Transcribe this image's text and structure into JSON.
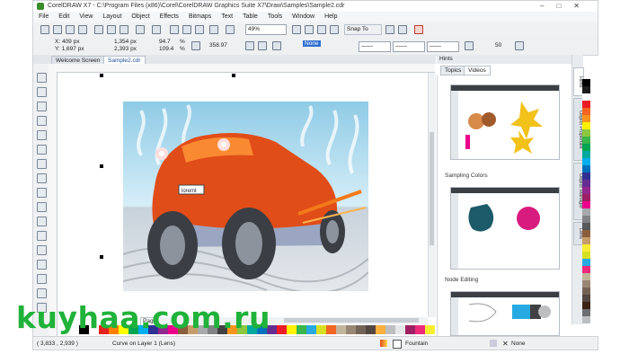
{
  "window": {
    "title": "CorelDRAW X7 - C:\\Program Files (x86)\\Corel\\CorelDRAW Graphics Suite X7\\Draw\\Samples\\Sample2.cdr"
  },
  "menu": [
    "File",
    "Edit",
    "View",
    "Layout",
    "Object",
    "Effects",
    "Bitmaps",
    "Text",
    "Table",
    "Tools",
    "Window",
    "Help"
  ],
  "toolbar": {
    "zoom": "49%",
    "snap_label": "Snap To"
  },
  "properties": {
    "x": "X: 409 px",
    "y": "Y: 1,697 px",
    "w": "1,354 px",
    "h": "2,393 px",
    "sx": "94.7",
    "sy": "109.4",
    "pct1": "%",
    "pct2": "%",
    "angle": "358.97",
    "outline": "None",
    "nodes": "50"
  },
  "doc_tabs": [
    "Welcome Screen",
    "Sample2.cdr"
  ],
  "art": {
    "plate_text": "loremt"
  },
  "page_tab": "Pag",
  "hints": {
    "title": "Hints",
    "tabs": [
      "Topics",
      "Videos"
    ],
    "items": [
      {
        "label": ""
      },
      {
        "label": "Sampling Colors"
      },
      {
        "label": "Node Editing"
      }
    ]
  },
  "docker_tabs": [
    "Hints",
    "Object Properties",
    "Object Manager",
    "Lens"
  ],
  "status": {
    "coords": "( 3,833 , 2,939 )",
    "info": "Curve on Layer 1  (Lens)",
    "fill": "Fountain",
    "outline": "None"
  },
  "palette": [
    "#000000",
    "#ffffff",
    "#e62020",
    "#ff7f00",
    "#ffff00",
    "#00a651",
    "#00aeef",
    "#2e3192",
    "#92278f",
    "#ec008c",
    "#8b5e3c",
    "#c69c6d",
    "#a7a9ac",
    "#808285",
    "#414042",
    "#f7941d",
    "#8dc63f",
    "#00a99d",
    "#0072bc",
    "#662d91",
    "#ed1c24",
    "#fff200",
    "#39b54a",
    "#27aae1",
    "#d7df23",
    "#f26522",
    "#c2b59b",
    "#998675",
    "#736357",
    "#534741",
    "#fbb040",
    "#bcbec0",
    "#e6e7e8",
    "#9e1f63",
    "#ee2a7b",
    "#f9ed32"
  ],
  "palette_right": [
    "#000000",
    "#1c1c1c",
    "#ffffff",
    "#ed1c24",
    "#f26522",
    "#f7941d",
    "#fff200",
    "#8dc63f",
    "#39b54a",
    "#00a651",
    "#00a99d",
    "#00aeef",
    "#0072bc",
    "#2e3192",
    "#662d91",
    "#92278f",
    "#9e1f63",
    "#ec008c",
    "#a7a9ac",
    "#808285",
    "#58595b",
    "#8b5e3c",
    "#c69c6d",
    "#f9ed32",
    "#d7df23",
    "#27aae1",
    "#ee2a7b",
    "#c2b59b",
    "#998675",
    "#736357",
    "#534741",
    "#3c2415",
    "#6d6e71",
    "#bcbec0"
  ],
  "watermark": "kuyhaa.com.ru",
  "colors": {
    "accent": "#1a4f9b",
    "watermark": "#20b23a"
  }
}
